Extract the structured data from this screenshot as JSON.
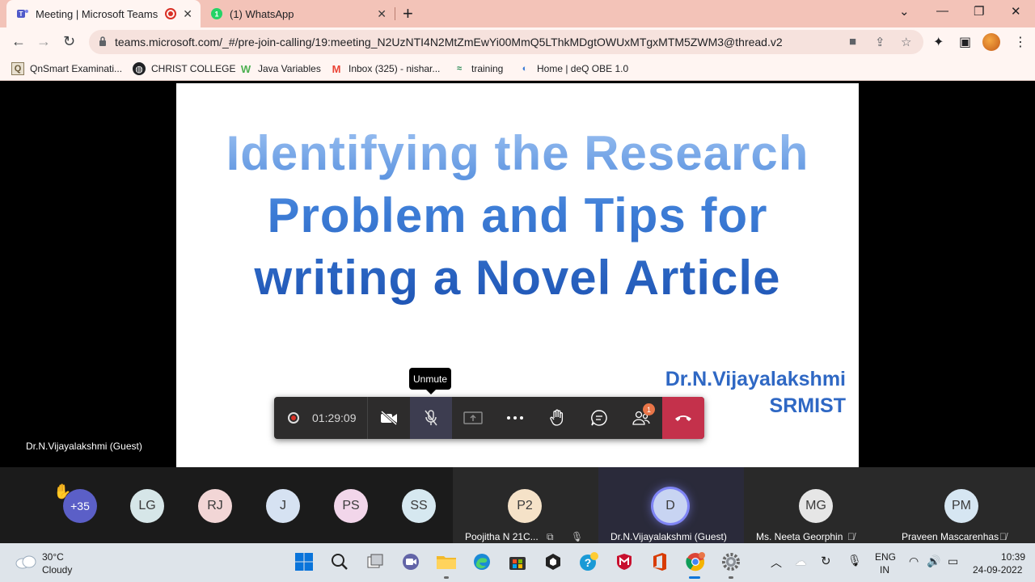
{
  "browser": {
    "tabs": [
      {
        "title": "Meeting | Microsoft Teams"
      },
      {
        "title": "(1) WhatsApp"
      }
    ],
    "url": "teams.microsoft.com/_#/pre-join-calling/19:meeting_N2UzNTI4N2MtZmEwYi00MmQ5LThkMDgtOWUxMTgxMTM5ZWM3@thread.v2",
    "bookmarks": [
      {
        "label": "QnSmart Examinati..."
      },
      {
        "label": "CHRIST COLLEGE"
      },
      {
        "label": "Java Variables"
      },
      {
        "label": "Inbox (325) - nishar..."
      },
      {
        "label": "training"
      },
      {
        "label": "Home | deQ OBE 1.0"
      }
    ]
  },
  "slide": {
    "title_lines": [
      "Identifying the Research",
      "Problem and Tips for",
      "writing a Novel Article"
    ],
    "author_lines": [
      "Dr.N.Vijayalakshmi",
      "SRMIST"
    ]
  },
  "presenter_label": "Dr.N.Vijayalakshmi (Guest)",
  "controls": {
    "timer": "01:29:09",
    "tooltip": "Unmute",
    "participants_badge": "1"
  },
  "participants": {
    "overflow": "+35",
    "avatars": [
      {
        "initials": "LG",
        "color": "#d6e6e8"
      },
      {
        "initials": "RJ",
        "color": "#f2d6d6"
      },
      {
        "initials": "J",
        "color": "#d6e2f2"
      },
      {
        "initials": "PS",
        "color": "#f2d6ea"
      },
      {
        "initials": "SS",
        "color": "#d6e8f0"
      }
    ],
    "tiles": [
      {
        "initials": "P2",
        "name": "Poojitha N 21C...",
        "color": "#f5e2c8"
      },
      {
        "initials": "D",
        "name": "Dr.N.Vijayalakshmi (Guest)",
        "color": "#c8d4f2"
      },
      {
        "initials": "MG",
        "name": "Ms. Neeta Georphin",
        "color": "#e6e6e6"
      },
      {
        "initials": "PM",
        "name": "Praveen Mascarenhas",
        "color": "#d6e6f2"
      }
    ]
  },
  "taskbar": {
    "weather_temp": "30°C",
    "weather_desc": "Cloudy",
    "lang_top": "ENG",
    "lang_bottom": "IN",
    "time": "10:39",
    "date": "24-09-2022"
  },
  "colors": {
    "hangup": "#c4314b",
    "slide_title": "#2a64c8",
    "tab_bar": "#f3c3b8"
  }
}
